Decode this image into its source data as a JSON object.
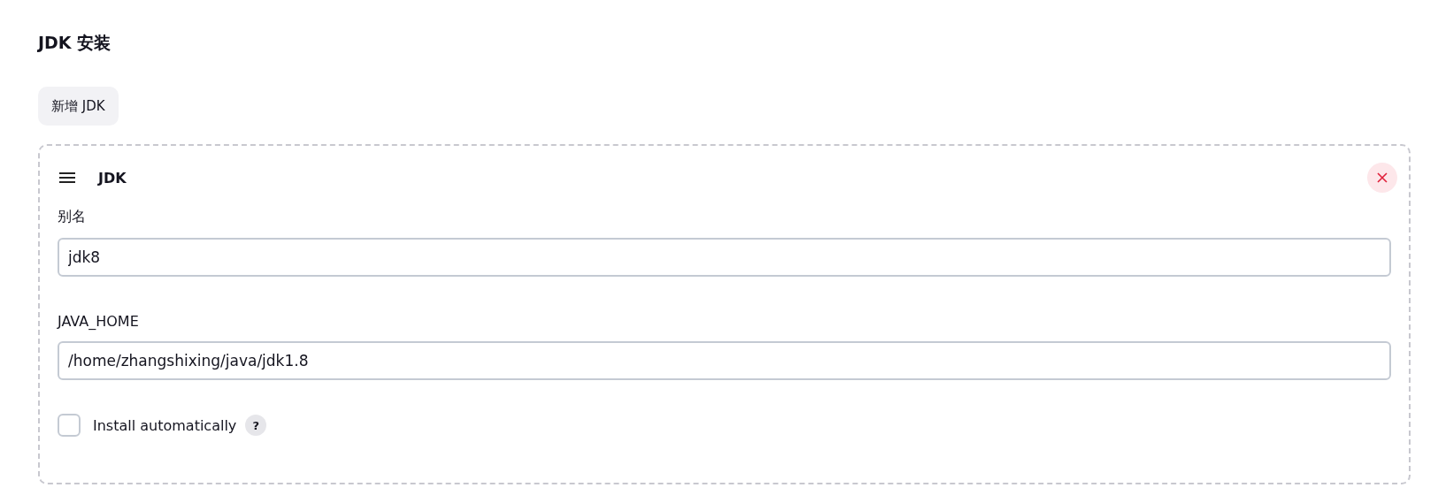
{
  "section_title": "JDK 安装",
  "add_button": "新增 JDK",
  "card": {
    "title": "JDK",
    "fields": [
      {
        "label": "别名",
        "value": "jdk8"
      },
      {
        "label": "JAVA_HOME",
        "value": "/home/zhangshixing/java/jdk1.8"
      }
    ],
    "checkbox": {
      "label": "Install automatically",
      "checked": false,
      "help": "?"
    }
  }
}
